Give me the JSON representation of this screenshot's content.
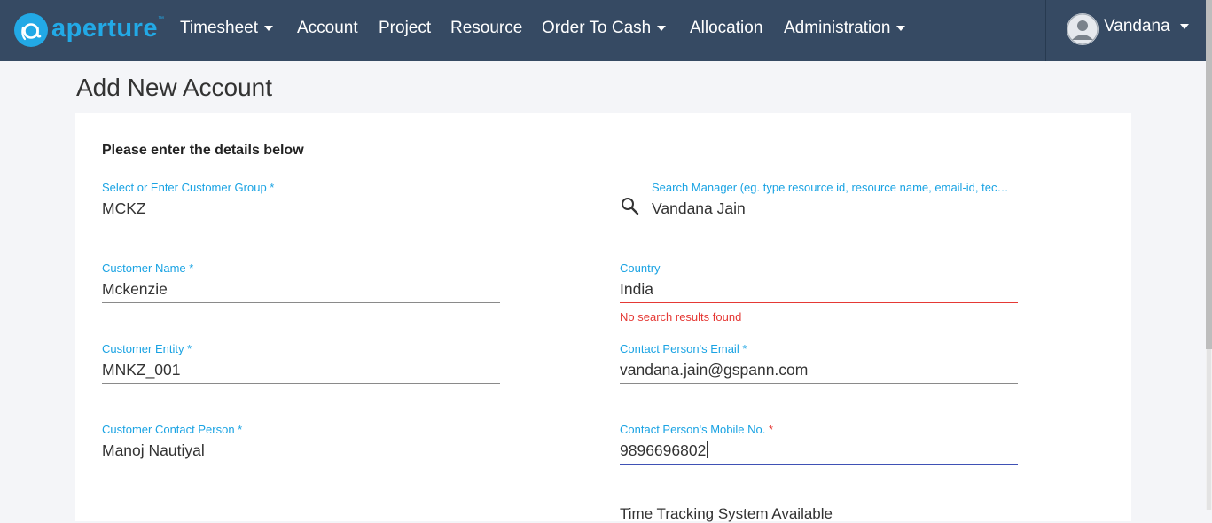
{
  "app": {
    "logo_text": "aperture",
    "logo_tm": "™",
    "brand_color": "#22a9e6",
    "navbar_color": "#364a63"
  },
  "nav": {
    "items": [
      {
        "label": "Timesheet",
        "dropdown": true
      },
      {
        "label": "Account",
        "dropdown": false
      },
      {
        "label": "Project",
        "dropdown": false
      },
      {
        "label": "Resource",
        "dropdown": false
      },
      {
        "label": "Order To Cash",
        "dropdown": true
      },
      {
        "label": "Allocation",
        "dropdown": false
      },
      {
        "label": "Administration",
        "dropdown": true
      }
    ],
    "user_name": "Vandana"
  },
  "page": {
    "title": "Add New Account",
    "form_heading": "Please enter the details below"
  },
  "form": {
    "customer_group": {
      "label": "Select or Enter Customer Group *",
      "value": "MCKZ"
    },
    "search_manager": {
      "label": "Search Manager (eg. type resource id, resource name, email-id, tec…",
      "value": "Vandana Jain",
      "icon": "search-icon"
    },
    "customer_name": {
      "label": "Customer Name *",
      "value": "Mckenzie"
    },
    "country": {
      "label": "Country",
      "value": "India",
      "error": "No search results found"
    },
    "customer_entity": {
      "label": "Customer Entity *",
      "value": "MNKZ_001"
    },
    "contact_email": {
      "label": "Contact Person's Email *",
      "value": "vandana.jain@gspann.com"
    },
    "contact_person": {
      "label": "Customer Contact Person *",
      "value": "Manoj Nautiyal"
    },
    "contact_mobile": {
      "label": "Contact Person's Mobile No.",
      "required_mark": "*",
      "value": "9896696802"
    },
    "cutoff_text": "Time Tracking System Available"
  },
  "colors": {
    "label": "#1aa3e3",
    "error": "#e53935",
    "focus": "#3f51b5"
  }
}
